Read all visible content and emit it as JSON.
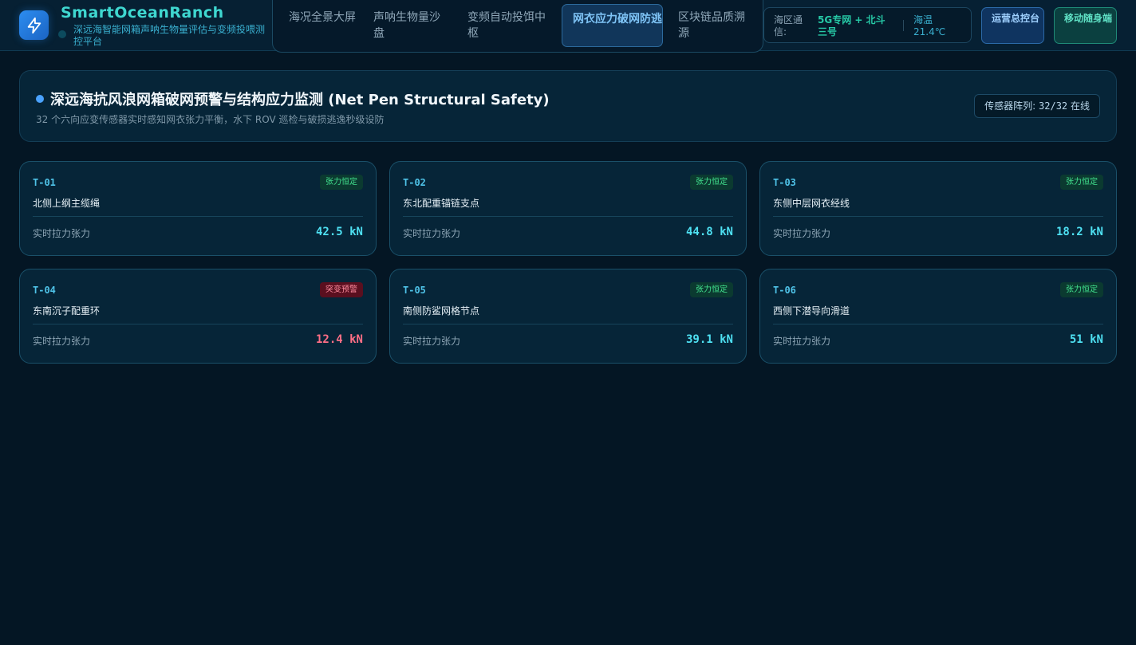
{
  "header": {
    "brand": "SmartOceanRanch",
    "subtitle": "深远海智能网箱声呐生物量评估与变频投喂测控平台",
    "nav": [
      {
        "label": "海况全景大屏",
        "active": false
      },
      {
        "label": "声呐生物量沙盘",
        "active": false
      },
      {
        "label": "变频自动投饵中枢",
        "active": false
      },
      {
        "label": "网衣应力破网防逃",
        "active": true
      },
      {
        "label": "区块链品质溯源",
        "active": false
      }
    ],
    "status": {
      "comm_label": "海区通信:",
      "comm_value": "5G专网 + 北斗三号",
      "sea_temp": "海温 21.4℃"
    },
    "ops_button": "运营总控台",
    "mobile_button": "移动随身端"
  },
  "panel": {
    "title": "深远海抗风浪网箱破网预警与结构应力监测 (Net Pen Structural Safety)",
    "description": "32 个六向应变传感器实时感知网衣张力平衡，水下 ROV 巡检与破损逃逸秒级设防",
    "sensor_label": "传感器阵列:",
    "sensor_value": "32/32",
    "sensor_status": "在线"
  },
  "cards": [
    {
      "id": "T-01",
      "name": "北侧上纲主缆绳",
      "status": "张力恒定",
      "status_type": "ok",
      "metric_label": "实时拉力张力",
      "value": "42.5 kN"
    },
    {
      "id": "T-02",
      "name": "东北配重锚链支点",
      "status": "张力恒定",
      "status_type": "ok",
      "metric_label": "实时拉力张力",
      "value": "44.8 kN"
    },
    {
      "id": "T-03",
      "name": "东侧中层网衣经线",
      "status": "张力恒定",
      "status_type": "ok",
      "metric_label": "实时拉力张力",
      "value": "18.2 kN"
    },
    {
      "id": "T-04",
      "name": "东南沉子配重环",
      "status": "突变预警",
      "status_type": "alert",
      "metric_label": "实时拉力张力",
      "value": "12.4 kN"
    },
    {
      "id": "T-05",
      "name": "南侧防鲨网格节点",
      "status": "张力恒定",
      "status_type": "ok",
      "metric_label": "实时拉力张力",
      "value": "39.1 kN"
    },
    {
      "id": "T-06",
      "name": "西侧下潜导向滑道",
      "status": "张力恒定",
      "status_type": "ok",
      "metric_label": "实时拉力张力",
      "value": "51 kN"
    }
  ],
  "colors": {
    "background": "#041624",
    "accent": "#4ee0f2",
    "ok": "#41e08d",
    "alert": "#ff6f86",
    "brand": "#3fd7d0"
  }
}
